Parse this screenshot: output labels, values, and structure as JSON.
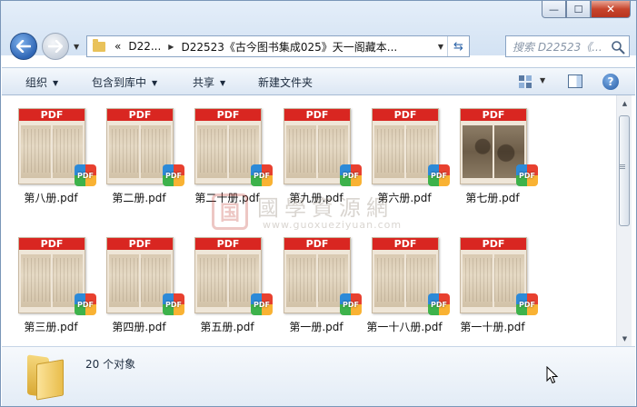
{
  "window": {
    "min_glyph": "—",
    "max_glyph": "☐",
    "close_glyph": "✕"
  },
  "address": {
    "crumb_overflow": "«",
    "crumb_parent": "D22...",
    "crumb_current": "D22523《古今图书集成025》天一阁藏本...",
    "search_placeholder": "搜索 D22523《..."
  },
  "toolbar": {
    "organize": "组织",
    "include_in_library": "包含到库中",
    "share": "共享",
    "new_folder": "新建文件夹",
    "help": "?"
  },
  "files": [
    {
      "name": "第八册.pdf",
      "style": "light"
    },
    {
      "name": "第二册.pdf",
      "style": "light"
    },
    {
      "name": "第二十册.pdf",
      "style": "light"
    },
    {
      "name": "第九册.pdf",
      "style": "light"
    },
    {
      "name": "第六册.pdf",
      "style": "light"
    },
    {
      "name": "第七册.pdf",
      "style": "dark"
    },
    {
      "name": "第三册.pdf",
      "style": "light"
    },
    {
      "name": "第四册.pdf",
      "style": "light"
    },
    {
      "name": "第五册.pdf",
      "style": "light"
    },
    {
      "name": "第一册.pdf",
      "style": "light"
    },
    {
      "name": "第一十八册.pdf",
      "style": "light"
    },
    {
      "name": "第一十册.pdf",
      "style": "light"
    }
  ],
  "thumb_band_label": "PDF",
  "badge_label": "PDF",
  "watermark": {
    "seal": "国",
    "title": "國學資源網",
    "url": "www.guoxueziyuan.com"
  },
  "status": {
    "count_text": "20 个对象"
  }
}
